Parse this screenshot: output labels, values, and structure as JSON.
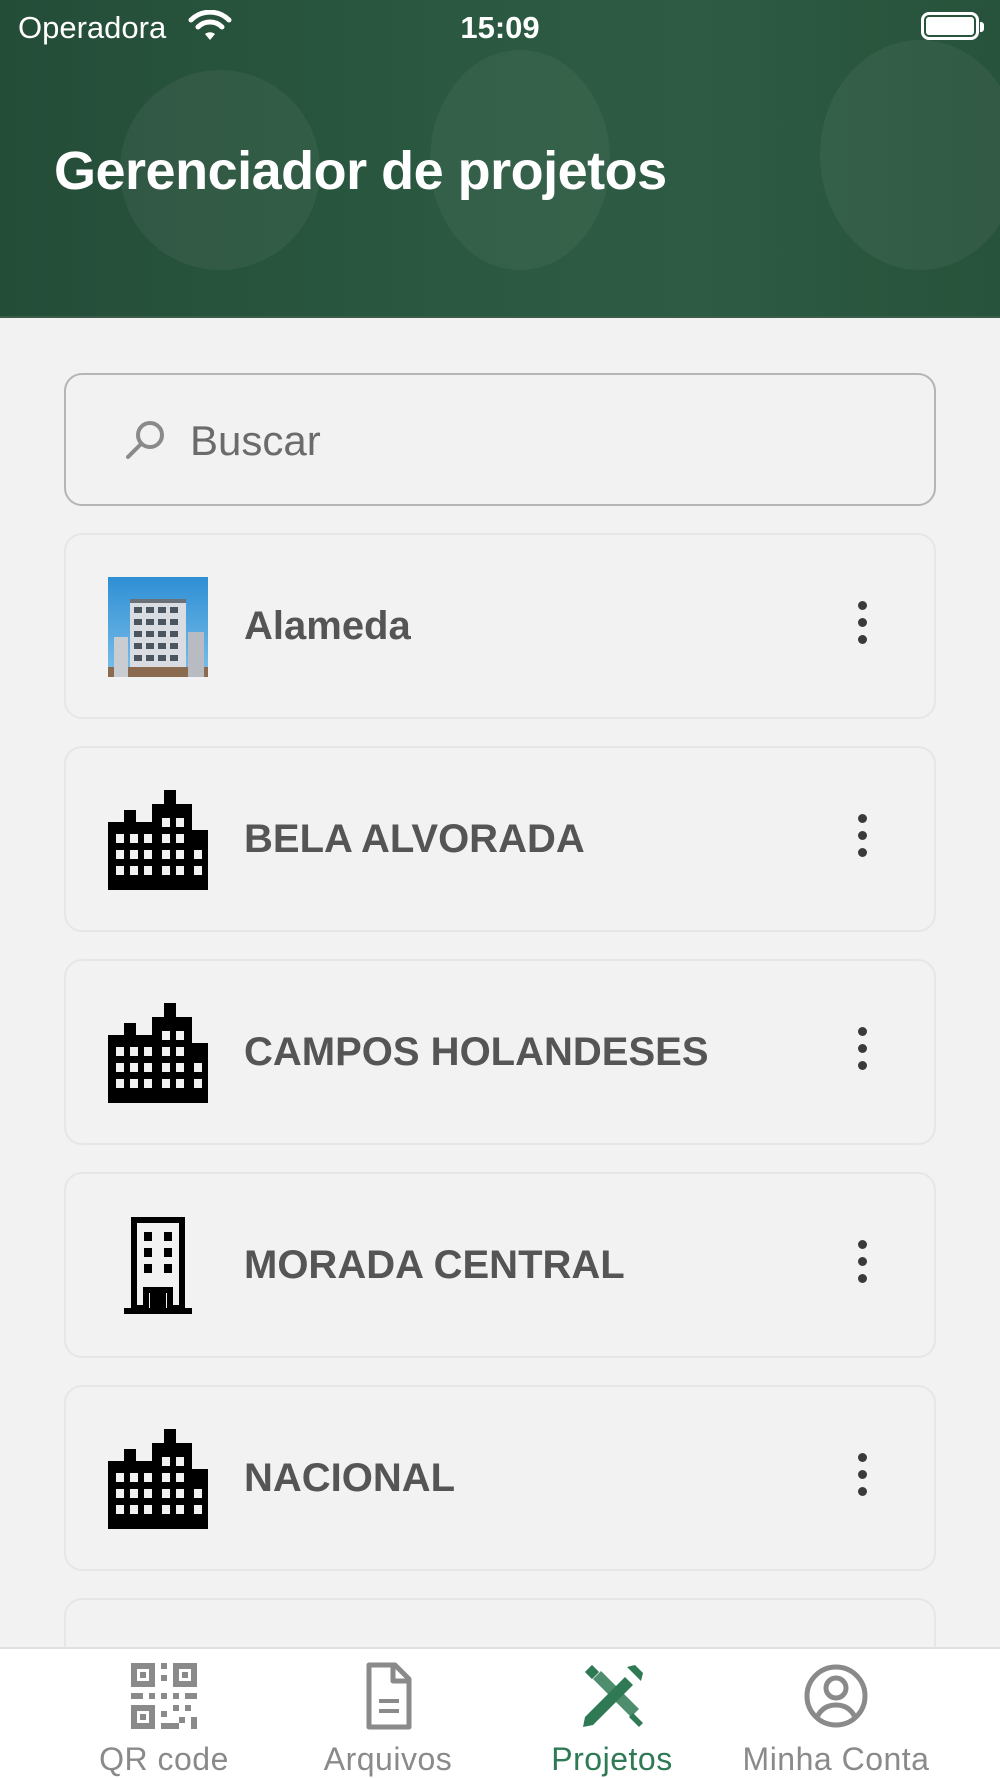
{
  "status_bar": {
    "carrier": "Operadora",
    "time": "15:09"
  },
  "header": {
    "title": "Gerenciador de projetos"
  },
  "search": {
    "placeholder": "Buscar",
    "icon": "search-icon"
  },
  "projects": [
    {
      "name": "Alameda",
      "icon": "building-photo"
    },
    {
      "name": "BELA ALVORADA",
      "icon": "city-icon"
    },
    {
      "name": "CAMPOS HOLANDESES",
      "icon": "city-icon"
    },
    {
      "name": "MORADA CENTRAL",
      "icon": "building-icon"
    },
    {
      "name": "NACIONAL",
      "icon": "city-icon"
    }
  ],
  "tabs": [
    {
      "label": "QR code",
      "icon": "qr-code-icon",
      "active": false
    },
    {
      "label": "Arquivos",
      "icon": "file-icon",
      "active": false
    },
    {
      "label": "Projetos",
      "icon": "tools-icon",
      "active": true
    },
    {
      "label": "Minha Conta",
      "icon": "account-icon",
      "active": false
    }
  ],
  "colors": {
    "header_bg": "#2a5840",
    "accent": "#2f7a55",
    "background": "#f2f2f2"
  }
}
